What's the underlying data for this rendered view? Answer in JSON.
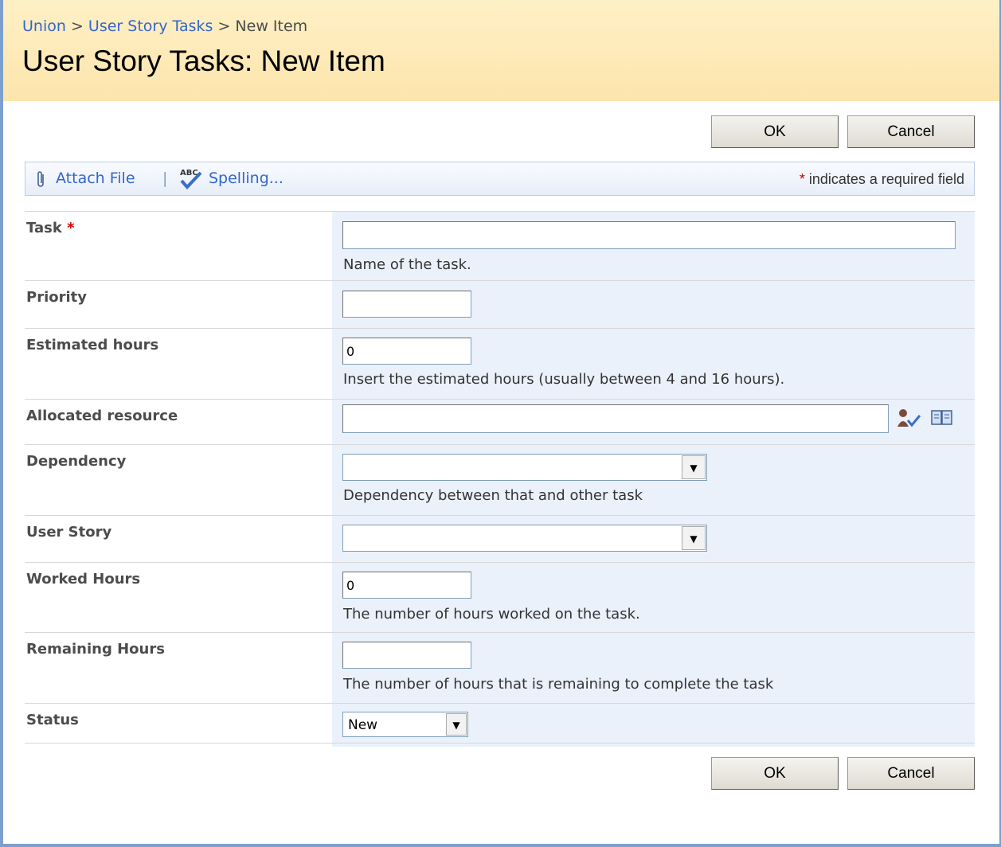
{
  "breadcrumb": {
    "site": "Union",
    "list": "User Story Tasks",
    "current": "New Item",
    "separator": ">"
  },
  "page_title": "User Story Tasks: New Item",
  "buttons": {
    "ok": "OK",
    "cancel": "Cancel"
  },
  "toolbar": {
    "attach": "Attach File",
    "divider": "|",
    "spelling": "Spelling...",
    "required_star": "*",
    "required_text": " indicates a required field"
  },
  "fields": {
    "task": {
      "label": "Task",
      "required": "*",
      "value": "",
      "description": "Name of the task."
    },
    "priority": {
      "label": "Priority",
      "value": ""
    },
    "estimated_hours": {
      "label": "Estimated hours",
      "value": "0",
      "description": "Insert the estimated hours (usually between 4 and 16 hours)."
    },
    "allocated_resource": {
      "label": "Allocated resource",
      "value": ""
    },
    "dependency": {
      "label": "Dependency",
      "value": "",
      "description": "Dependency between that and other task"
    },
    "user_story": {
      "label": "User Story",
      "value": ""
    },
    "worked_hours": {
      "label": "Worked Hours",
      "value": "0",
      "description": "The number of hours worked on the task."
    },
    "remaining_hours": {
      "label": "Remaining Hours",
      "value": "",
      "description": "The number of hours that is remaining to complete the task"
    },
    "status": {
      "label": "Status",
      "value": "New"
    }
  },
  "icons": {
    "attach": "paperclip-icon",
    "spelling": "spellcheck-icon",
    "check_names": "check-names-icon",
    "browse": "address-book-icon",
    "dropdown": "dropdown-arrow-icon"
  },
  "colors": {
    "header": "#fde5ad",
    "link": "#3366cc",
    "field_bg": "#ebf1fb",
    "required": "#cc0000",
    "frame": "#7ba0cd"
  }
}
